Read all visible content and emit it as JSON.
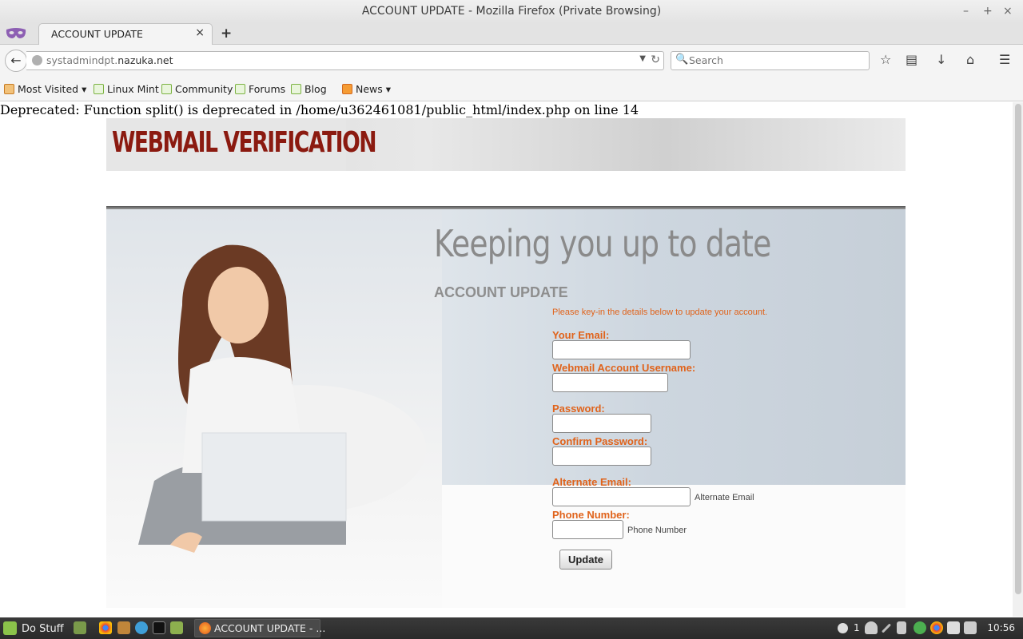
{
  "window": {
    "title": "ACCOUNT UPDATE - Mozilla Firefox (Private Browsing)",
    "minimize": "–",
    "maximize": "+",
    "close": "×"
  },
  "tab": {
    "title": "ACCOUNT UPDATE",
    "close": "×",
    "new_tab": "+"
  },
  "navbar": {
    "url_prefix": "systadmindpt.",
    "url_domain": "nazuka.net",
    "search_placeholder": "Search"
  },
  "bookmarks": [
    {
      "label": "Most Visited",
      "icon": "folder-icon"
    },
    {
      "label": "Linux Mint",
      "icon": "mint-icon"
    },
    {
      "label": "Community",
      "icon": "mint-icon"
    },
    {
      "label": "Forums",
      "icon": "mint-icon"
    },
    {
      "label": "Blog",
      "icon": "mint-icon"
    },
    {
      "label": "News",
      "icon": "rss-icon"
    }
  ],
  "page": {
    "deprecated": "Deprecated: Function split() is deprecated in /home/u362461081/public_html/index.php on line 14",
    "banner_logo": "WEBMAIL VERIFICATION",
    "heading": "Keeping you up to date",
    "subheading": "ACCOUNT UPDATE",
    "info": "Please key-in the details below to update your account.",
    "form": {
      "email_label": "Your Email:",
      "username_label": "Webmail Account Username:",
      "password_label": "Password:",
      "confirm_label": "Confirm Password:",
      "alt_email_label": "Alternate Email:",
      "alt_email_hint": "Alternate Email",
      "phone_label": "Phone Number:",
      "phone_hint": "Phone Number",
      "submit": "Update"
    }
  },
  "taskbar": {
    "menu_label": "Do Stuff",
    "window_label": "ACCOUNT UPDATE - ...",
    "notification_count": "1",
    "clock": "10:56"
  },
  "colors": {
    "accent_orange": "#e0631b",
    "logo_red": "#8b1a10"
  }
}
